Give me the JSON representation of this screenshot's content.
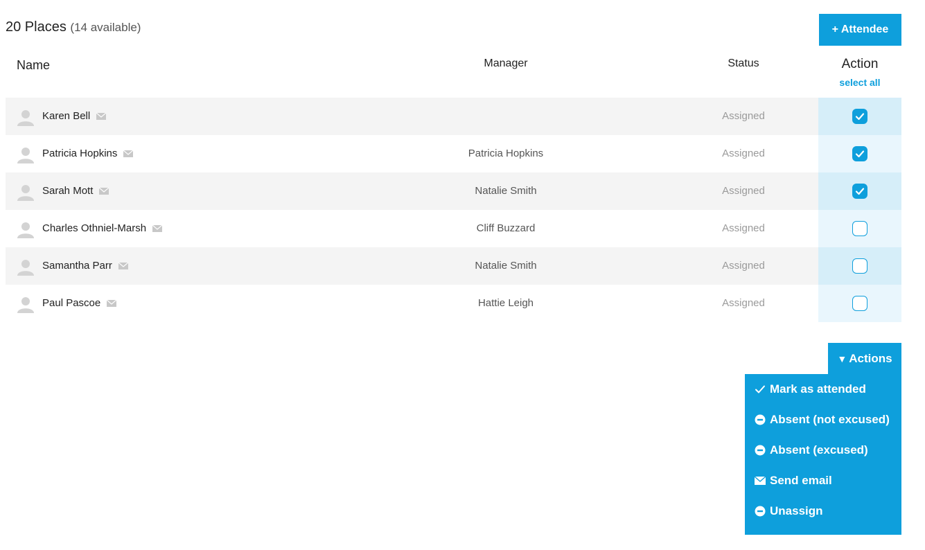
{
  "summary": {
    "places": "20 Places",
    "available": "(14 available)"
  },
  "buttons": {
    "add_attendee": "+ Attendee",
    "actions": "Actions"
  },
  "table": {
    "headers": {
      "name": "Name",
      "manager": "Manager",
      "status": "Status",
      "action": "Action",
      "select_all": "select all"
    },
    "rows": [
      {
        "name": "Karen Bell",
        "manager": "",
        "status": "Assigned",
        "checked": true
      },
      {
        "name": "Patricia Hopkins",
        "manager": "Patricia Hopkins",
        "status": "Assigned",
        "checked": true
      },
      {
        "name": "Sarah Mott",
        "manager": "Natalie Smith",
        "status": "Assigned",
        "checked": true
      },
      {
        "name": "Charles Othniel-Marsh",
        "manager": "Cliff Buzzard",
        "status": "Assigned",
        "checked": false
      },
      {
        "name": "Samantha Parr",
        "manager": "Natalie Smith",
        "status": "Assigned",
        "checked": false
      },
      {
        "name": "Paul Pascoe",
        "manager": "Hattie Leigh",
        "status": "Assigned",
        "checked": false
      }
    ]
  },
  "actions_menu": {
    "items": [
      {
        "label": "Mark as attended",
        "icon": "check-icon"
      },
      {
        "label": "Absent (not excused)",
        "icon": "minus-circle-icon"
      },
      {
        "label": "Absent (excused)",
        "icon": "minus-circle-icon"
      },
      {
        "label": "Send email",
        "icon": "envelope-icon"
      },
      {
        "label": "Unassign",
        "icon": "minus-circle-icon"
      }
    ]
  },
  "colors": {
    "accent": "#0e9fdc",
    "row_alt": "#f4f4f4",
    "action_col_odd": "#d6eef9",
    "action_col_even": "#e9f6fd"
  }
}
